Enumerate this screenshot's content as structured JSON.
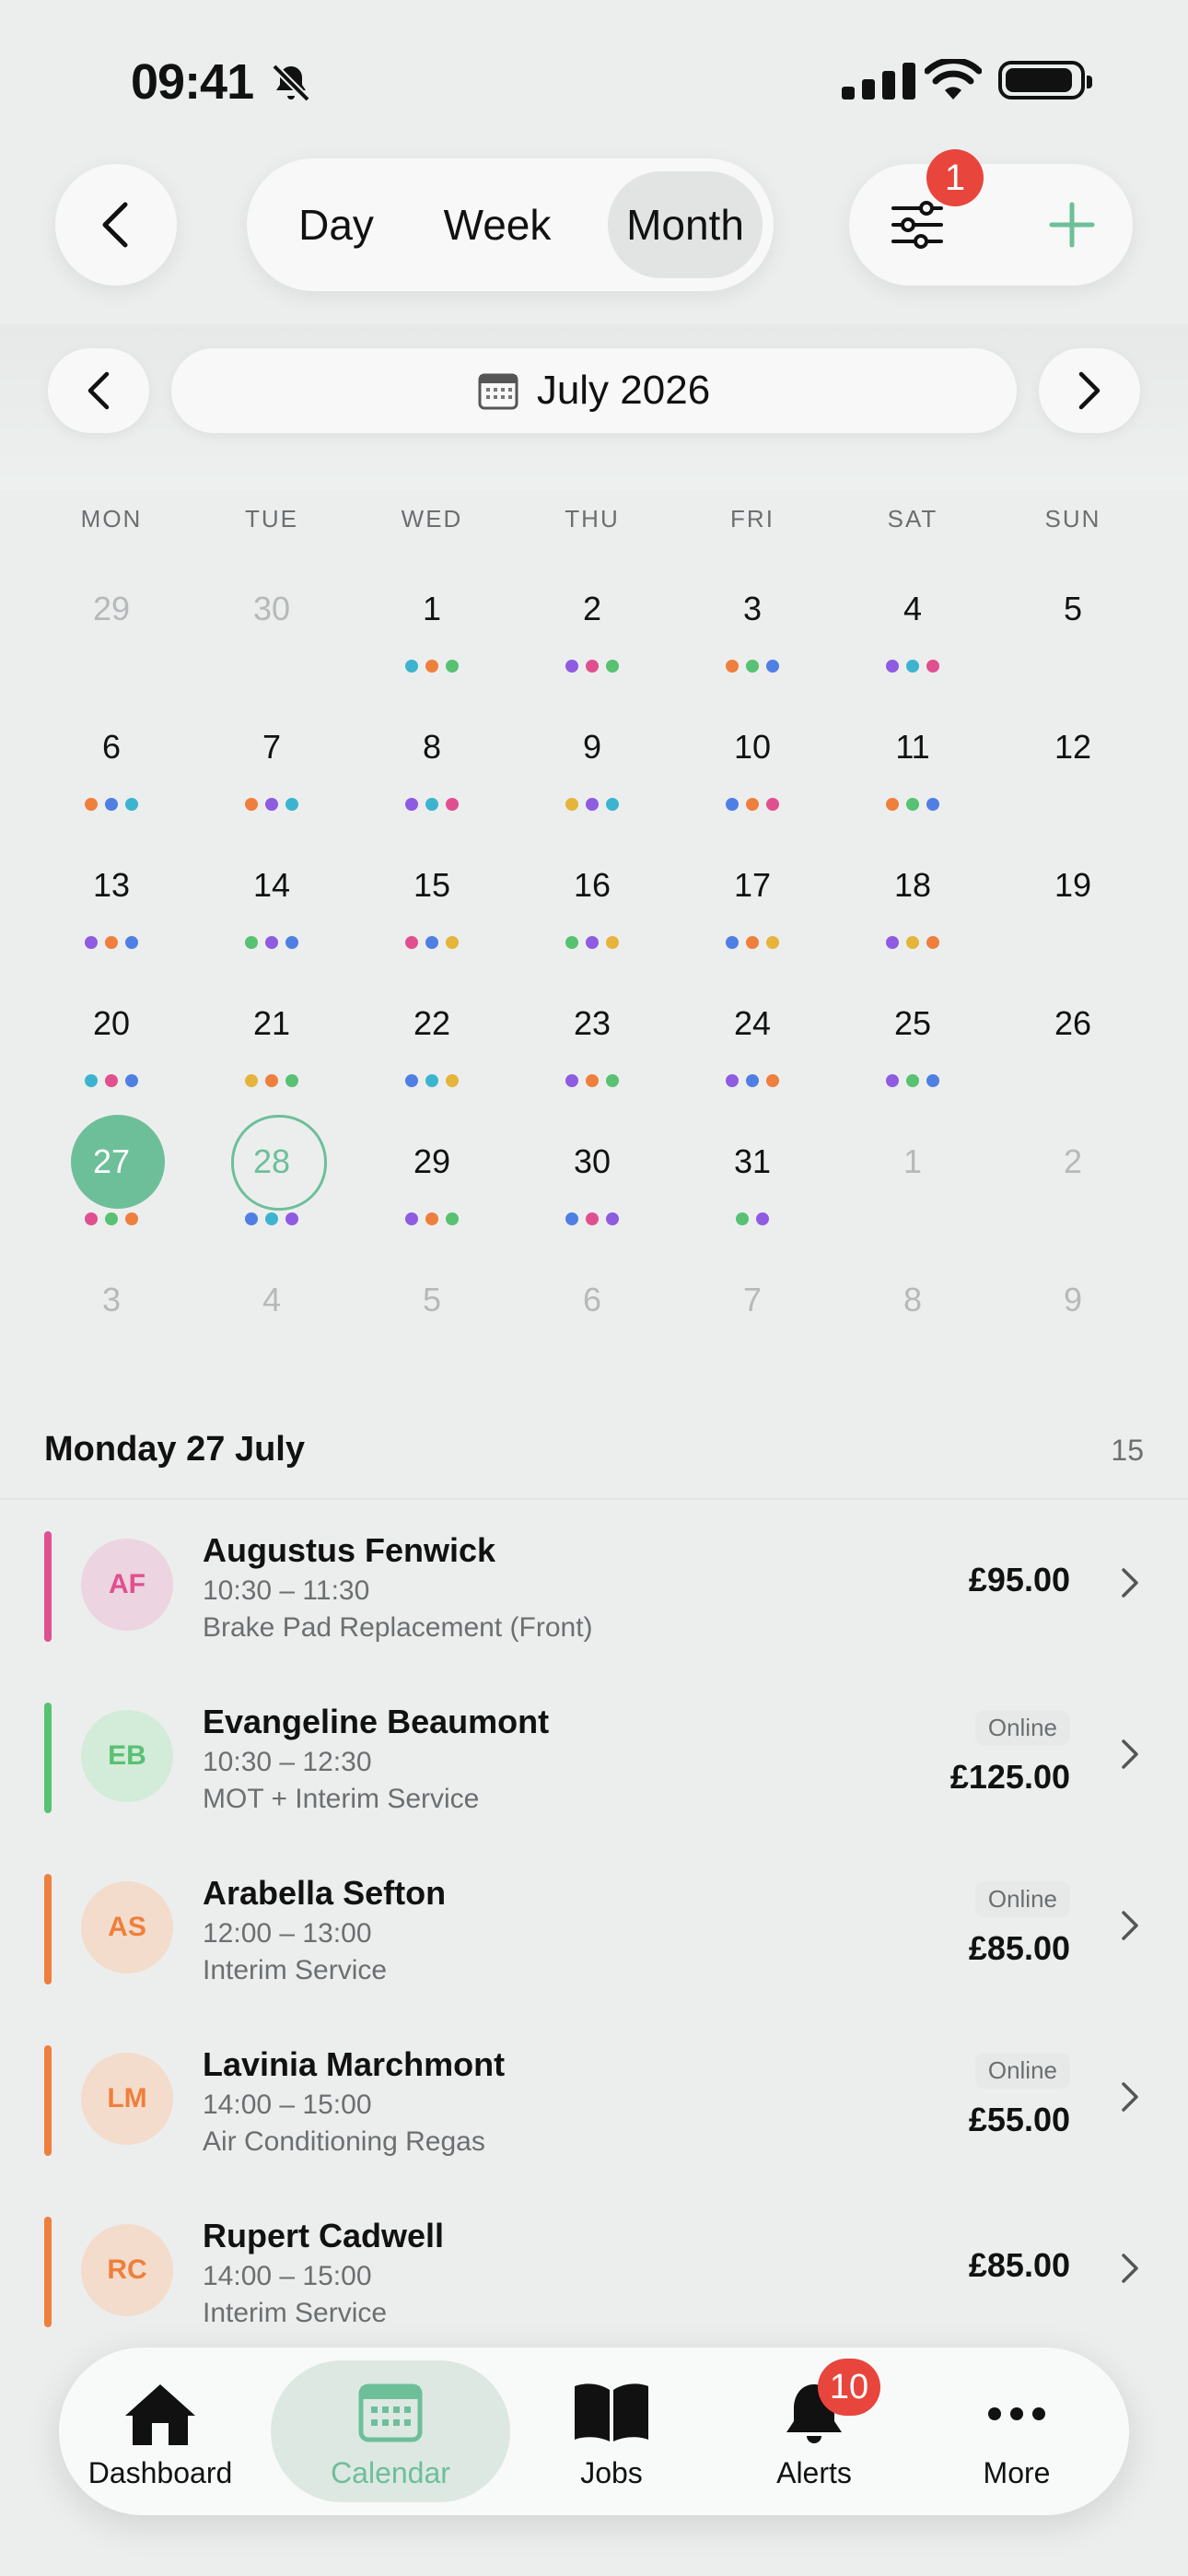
{
  "status": {
    "time": "09:41"
  },
  "header": {
    "view_modes": [
      "Day",
      "Week",
      "Month"
    ],
    "selected_view": "Month",
    "filter_badge": "1"
  },
  "month_nav": {
    "label": "July 2026"
  },
  "weekdays": [
    "MON",
    "TUE",
    "WED",
    "THU",
    "FRI",
    "SAT",
    "SUN"
  ],
  "colors": {
    "accent": "#6dbf9a",
    "orange": "#ef7f3c",
    "blue": "#4f7fe3",
    "teal": "#3db4cf",
    "purple": "#8f5be0",
    "pink": "#e0508f",
    "green": "#58c172",
    "yellow": "#e5b43a",
    "badge_red": "#e8453c"
  },
  "calendar": {
    "weeks": [
      [
        {
          "d": "29",
          "dim": true,
          "dots": []
        },
        {
          "d": "30",
          "dim": true,
          "dots": []
        },
        {
          "d": "1",
          "dots": [
            "teal",
            "orange",
            "green"
          ]
        },
        {
          "d": "2",
          "dots": [
            "purple",
            "pink",
            "green"
          ]
        },
        {
          "d": "3",
          "dots": [
            "orange",
            "green",
            "blue"
          ]
        },
        {
          "d": "4",
          "dots": [
            "purple",
            "teal",
            "pink"
          ]
        },
        {
          "d": "5",
          "dots": []
        }
      ],
      [
        {
          "d": "6",
          "dots": [
            "orange",
            "blue",
            "teal"
          ]
        },
        {
          "d": "7",
          "dots": [
            "orange",
            "purple",
            "teal"
          ]
        },
        {
          "d": "8",
          "dots": [
            "purple",
            "teal",
            "pink"
          ]
        },
        {
          "d": "9",
          "dots": [
            "yellow",
            "purple",
            "teal"
          ]
        },
        {
          "d": "10",
          "dots": [
            "blue",
            "orange",
            "pink"
          ]
        },
        {
          "d": "11",
          "dots": [
            "orange",
            "green",
            "blue"
          ]
        },
        {
          "d": "12",
          "dots": []
        }
      ],
      [
        {
          "d": "13",
          "dots": [
            "purple",
            "orange",
            "blue"
          ]
        },
        {
          "d": "14",
          "dots": [
            "green",
            "purple",
            "blue"
          ]
        },
        {
          "d": "15",
          "dots": [
            "pink",
            "blue",
            "yellow"
          ]
        },
        {
          "d": "16",
          "dots": [
            "green",
            "purple",
            "yellow"
          ]
        },
        {
          "d": "17",
          "dots": [
            "blue",
            "orange",
            "yellow"
          ]
        },
        {
          "d": "18",
          "dots": [
            "purple",
            "yellow",
            "orange"
          ]
        },
        {
          "d": "19",
          "dots": []
        }
      ],
      [
        {
          "d": "20",
          "dots": [
            "teal",
            "pink",
            "blue"
          ]
        },
        {
          "d": "21",
          "dots": [
            "yellow",
            "orange",
            "green"
          ]
        },
        {
          "d": "22",
          "dots": [
            "blue",
            "teal",
            "yellow"
          ]
        },
        {
          "d": "23",
          "dots": [
            "purple",
            "orange",
            "green"
          ]
        },
        {
          "d": "24",
          "dots": [
            "purple",
            "blue",
            "orange"
          ]
        },
        {
          "d": "25",
          "dots": [
            "purple",
            "green",
            "blue"
          ]
        },
        {
          "d": "26",
          "dots": []
        }
      ],
      [
        {
          "d": "27",
          "today": true,
          "dots": [
            "pink",
            "green",
            "orange"
          ]
        },
        {
          "d": "28",
          "selected": true,
          "dots": [
            "blue",
            "teal",
            "purple"
          ]
        },
        {
          "d": "29",
          "dots": [
            "purple",
            "orange",
            "green"
          ]
        },
        {
          "d": "30",
          "dots": [
            "blue",
            "pink",
            "purple"
          ]
        },
        {
          "d": "31",
          "dots": [
            "green",
            "purple"
          ]
        },
        {
          "d": "1",
          "dim": true,
          "dots": []
        },
        {
          "d": "2",
          "dim": true,
          "dots": []
        }
      ],
      [
        {
          "d": "3",
          "dim": true,
          "dots": []
        },
        {
          "d": "4",
          "dim": true,
          "dots": []
        },
        {
          "d": "5",
          "dim": true,
          "dots": []
        },
        {
          "d": "6",
          "dim": true,
          "dots": []
        },
        {
          "d": "7",
          "dim": true,
          "dots": []
        },
        {
          "d": "8",
          "dim": true,
          "dots": []
        },
        {
          "d": "9",
          "dim": true,
          "dots": []
        }
      ]
    ]
  },
  "day_list": {
    "title": "Monday 27 July",
    "count": "15",
    "bookings": [
      {
        "initials": "AF",
        "name": "Augustus Fenwick",
        "time": "10:30 – 11:30",
        "service": "Brake Pad Replacement (Front)",
        "price": "£95.00",
        "channel": "",
        "color": "pink"
      },
      {
        "initials": "EB",
        "name": "Evangeline Beaumont",
        "time": "10:30 – 12:30",
        "service": "MOT + Interim Service",
        "price": "£125.00",
        "channel": "Online",
        "color": "green"
      },
      {
        "initials": "AS",
        "name": "Arabella Sefton",
        "time": "12:00 – 13:00",
        "service": "Interim Service",
        "price": "£85.00",
        "channel": "Online",
        "color": "orange"
      },
      {
        "initials": "LM",
        "name": "Lavinia Marchmont",
        "time": "14:00 – 15:00",
        "service": "Air Conditioning Regas",
        "price": "£55.00",
        "channel": "Online",
        "color": "orange"
      },
      {
        "initials": "RC",
        "name": "Rupert Cadwell",
        "time": "14:00 – 15:00",
        "service": "Interim Service",
        "price": "£85.00",
        "channel": "",
        "color": "orange"
      }
    ]
  },
  "tabbar": {
    "items": [
      "Dashboard",
      "Calendar",
      "Jobs",
      "Alerts",
      "More"
    ],
    "active": "Calendar",
    "alerts_badge": "10"
  }
}
